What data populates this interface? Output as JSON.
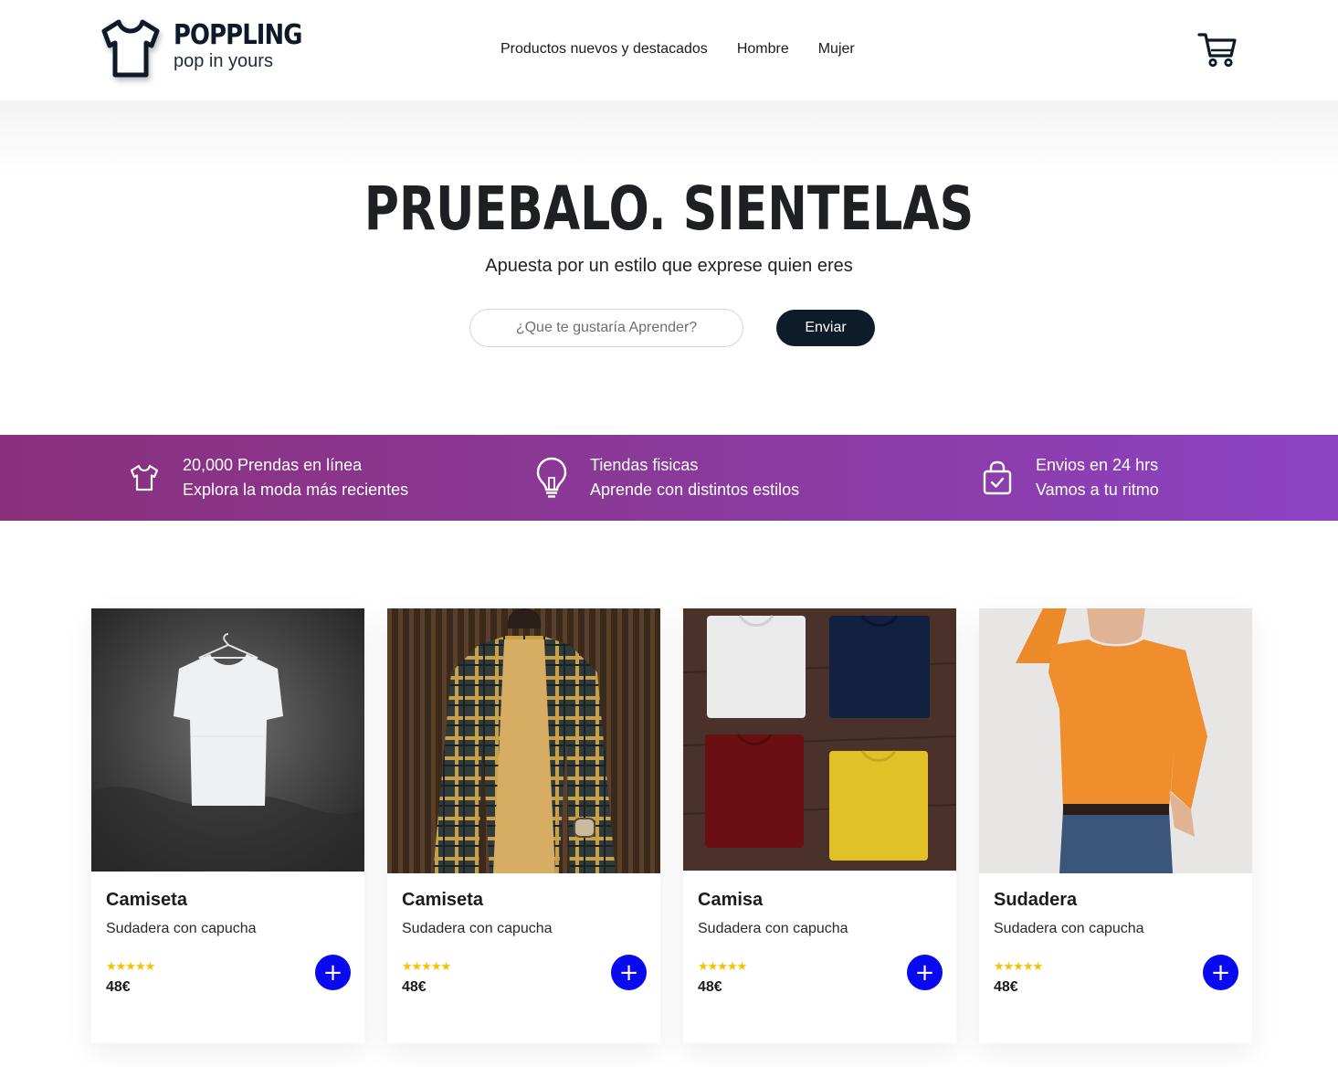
{
  "brand": {
    "name": "POPPLING",
    "tagline": "pop in yours",
    "logo_icon": "tshirt-icon"
  },
  "nav": {
    "items": [
      {
        "label": "Productos nuevos y destacados"
      },
      {
        "label": "Hombre"
      },
      {
        "label": "Mujer"
      }
    ]
  },
  "cart": {
    "icon": "cart-icon"
  },
  "hero": {
    "title": "PRUEBALO. SIENTELAS",
    "subtitle": "Apuesta por un estilo que exprese quien eres",
    "search_placeholder": "¿Que te gustaría Aprender?",
    "button_label": "Enviar"
  },
  "features": [
    {
      "icon": "tshirt-icon",
      "line1": "20,000 Prendas en línea",
      "line2": "Explora la moda más recientes"
    },
    {
      "icon": "lightbulb-icon",
      "line1": "Tiendas fisicas",
      "line2": "Aprende con distintos estilos"
    },
    {
      "icon": "shopping-bag-check-icon",
      "line1": "Envios en 24 hrs",
      "line2": "Vamos a tu ritmo"
    }
  ],
  "products": [
    {
      "name": "Camiseta",
      "description": "Sudadera con capucha",
      "rating": "★★★★★",
      "price": "48€",
      "image": "white-tshirt-on-hanger"
    },
    {
      "name": "Camiseta",
      "description": "Sudadera con capucha",
      "rating": "★★★★★",
      "price": "48€",
      "image": "man-in-plaid-shirt"
    },
    {
      "name": "Camisa",
      "description": "Sudadera con capucha",
      "rating": "★★★★★",
      "price": "48€",
      "image": "folded-tshirts"
    },
    {
      "name": "Sudadera",
      "description": "Sudadera con capucha",
      "rating": "★★★★★",
      "price": "48€",
      "image": "woman-in-orange-sweater"
    }
  ],
  "colors": {
    "dark": "#0d1b2a",
    "band_start": "#8a2f7c",
    "band_end": "#8d42c2",
    "add_button": "#0a0af0",
    "stars": "#f2c200"
  }
}
